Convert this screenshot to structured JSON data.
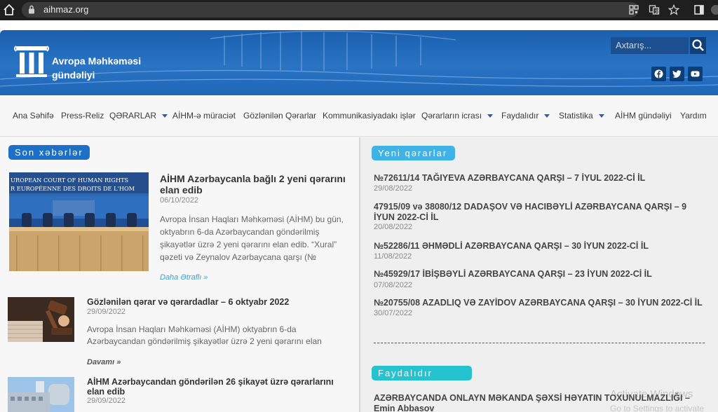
{
  "browser": {
    "url": "aihmaz.org"
  },
  "header": {
    "logo_line1": "Avropa Məhkəməsi",
    "logo_line2": "gündəliyi",
    "search_placeholder": "Axtarış...",
    "brand_color": "#1e66b8"
  },
  "nav": {
    "items": [
      {
        "label": "Ana Səhifə"
      },
      {
        "label": "Press-Reliz"
      },
      {
        "label": "QƏRARLAR"
      },
      {
        "label": "AİHM-ə müraciət"
      },
      {
        "label": "Gözlənilən Qərarlar"
      },
      {
        "label": "Kommunikasiyadakı işlər"
      },
      {
        "label": "Qərarların icrası"
      },
      {
        "label": "Faydalıdır"
      },
      {
        "label": "Statistika"
      },
      {
        "label": "AİHM gündəliyi"
      },
      {
        "label": "Yardım"
      }
    ]
  },
  "news": {
    "heading": "Son xəbərlər",
    "main": {
      "image_text_line1": "UROPEAN COURT OF HUMAN RIGHTS",
      "image_text_line2": "R EUROPÉENNE DES DROITS DE L'HOM",
      "title": "AİHM Azərbaycanla bağlı 2 yeni qərarını elan edib",
      "date": "06/10/2022",
      "excerpt": "Avropa İnsan Haqları Məhkəməsi (AİHM) bu gün, oktyabrın 6-da Azərbaycandan göndərilmiş şikayətlər üzrə 2 yeni qərarını elan edib. “Xural” qəzeti və Zeynalov Azərbaycana qarşı (№",
      "more": "Daha Ətraflı »"
    },
    "second": {
      "title": "Gözlənilən qərar və qərardadlar – 6 oktyabr 2022",
      "date": "29/09/2022",
      "excerpt": "Avropa İnsan Haqları Məhkəməsi (AİHM) oktyabrın 6-da Azərbaycandan göndərilmiş şikayətlər üzrə 2 yeni qərarını elan",
      "more": "Davamı »"
    },
    "third": {
      "title": "AİHM Azərbaycandan göndərilən 26 şikayət üzrə qərarlarını elan edib",
      "date": "29/09/2022"
    }
  },
  "decisions": {
    "heading": "Yeni qərarlar",
    "items": [
      {
        "title": "№72611/14 TAĞIYEVA AZƏRBAYCANA QARŞI – 7 İYUL 2022-Cİ İL",
        "date": "29/08/2022"
      },
      {
        "title": "47915/09 və 38080/12 DADAŞOV VƏ HACIBƏYLİ AZƏRBAYCANA QARŞI – 9 İYUN 2022-Cİ İL",
        "date": "20/08/2022"
      },
      {
        "title": "№52286/11 ƏHMƏDLİ AZƏRBAYCANA QARŞI – 30 İYUN 2022-Cİ İL",
        "date": "11/08/2022"
      },
      {
        "title": "№45929/17 İBİŞBƏYLİ AZƏRBAYCANA QARŞI – 23 İYUN 2022-Cİ İL",
        "date": "07/08/2022"
      },
      {
        "title": "№20755/08 AZADLIQ VƏ ZAYİDOV AZƏRBAYCANA QARŞI – 30 İYUN 2022-Cİ İL",
        "date": "30/07/2022"
      }
    ]
  },
  "useful": {
    "heading": "Faydalıdır",
    "item_title": "AZƏRBAYCANDA ONLAYN MƏKANDA ŞƏXSİ HƏYATIN TOXUNULMAZLIĞI – Emin Abbasov"
  },
  "watermark": {
    "line1": "Activate Windows",
    "line2": "Go to Settings to activate"
  }
}
